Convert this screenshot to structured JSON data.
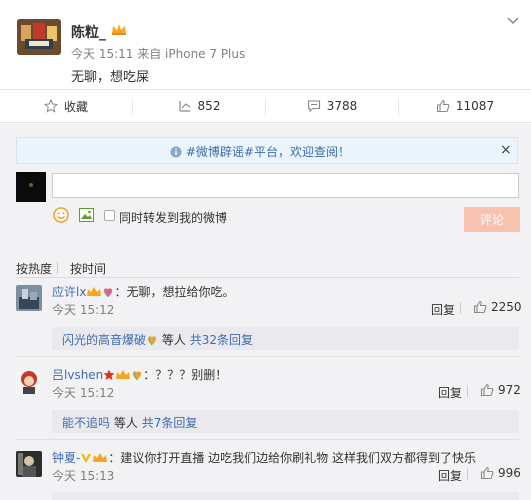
{
  "post": {
    "username": "陈粒_",
    "time": "今天 15:11",
    "source": "来自 iPhone 7 Plus",
    "text": "无聊，想吃屎"
  },
  "actions": {
    "favorite": "收藏",
    "repost_count": "852",
    "comment_count": "3788",
    "like_count": "11087"
  },
  "composer": {
    "banner": "#微博辟谣#平台，欢迎查阅！",
    "forward_label": "同时转发到我的微博",
    "submit": "评论"
  },
  "sort": {
    "by_hot": "按热度",
    "by_time": "按时间"
  },
  "comments": [
    {
      "user": "应许lx",
      "text": "：无聊，想拉给你吃。",
      "time": "今天 15:12",
      "reply": "回复",
      "likes": "2250",
      "sub_user": "闪光的高音爆破",
      "sub_more": "等人",
      "sub_link": "共32条回复"
    },
    {
      "user": "吕lvshen",
      "text": "：？？？别删！",
      "time": "今天 15:12",
      "reply": "回复",
      "likes": "972",
      "sub_user": "能不追吗",
      "sub_more": "等人",
      "sub_link": "共7条回复"
    },
    {
      "user": "钟夏-",
      "text": "：建议你打开直播 边吃我们边给你刷礼物 这样我们双方都得到了快乐",
      "time": "今天 15:13",
      "reply": "回复",
      "likes": "996"
    }
  ],
  "colors": {
    "link": "#eb7350",
    "name": "#3e6cb0",
    "submit_bg": "#f7c2ae",
    "banner_bg": "#eaf4fb"
  }
}
